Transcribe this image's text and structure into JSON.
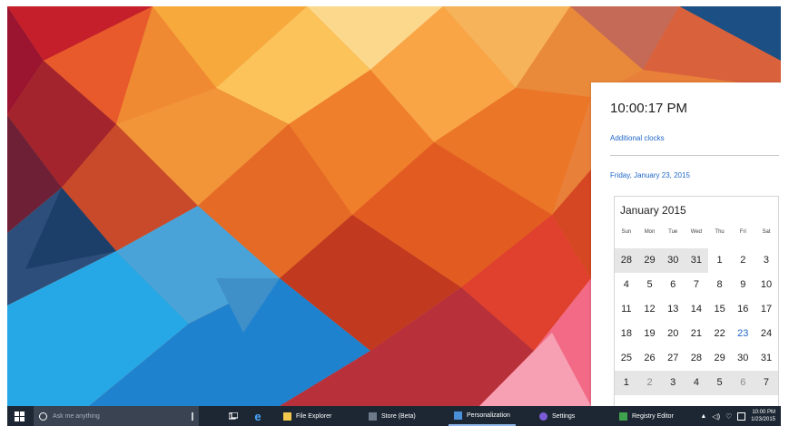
{
  "flyout": {
    "time": "10:00:17 PM",
    "additional_clocks": "Additional clocks",
    "date": "Friday, January 23, 2015",
    "month_title": "January 2015",
    "weekdays": [
      "Sun",
      "Mon",
      "Tue",
      "Wed",
      "Thu",
      "Fri",
      "Sat"
    ],
    "weeks": [
      [
        "28",
        "29",
        "30",
        "31",
        "1",
        "2",
        "3"
      ],
      [
        "4",
        "5",
        "6",
        "7",
        "8",
        "9",
        "10"
      ],
      [
        "11",
        "12",
        "13",
        "14",
        "15",
        "16",
        "17"
      ],
      [
        "18",
        "19",
        "20",
        "21",
        "22",
        "23",
        "24"
      ],
      [
        "25",
        "26",
        "27",
        "28",
        "29",
        "30",
        "31"
      ],
      [
        "1",
        "2",
        "3",
        "4",
        "5",
        "6",
        "7"
      ]
    ],
    "today": "23"
  },
  "taskbar": {
    "search_placeholder": "Ask me anything",
    "apps": [
      {
        "label": "File Explorer",
        "icon": "folder-icon",
        "color": "#f2c94c"
      },
      {
        "label": "Store (Beta)",
        "icon": "store-icon",
        "color": "#6c7a8a"
      },
      {
        "label": "Personalization",
        "icon": "personalization-icon",
        "color": "#4a90d9"
      },
      {
        "label": "Settings",
        "icon": "gear-icon",
        "color": "#7b5cd6"
      },
      {
        "label": "Registry Editor",
        "icon": "registry-icon",
        "color": "#3fa34d"
      }
    ],
    "clock_time": "10:00 PM",
    "clock_date": "1/23/2015"
  },
  "colors": {
    "accent": "#1f66c6",
    "taskbar": "#1d2733",
    "flyout_bg": "#ffffff"
  }
}
